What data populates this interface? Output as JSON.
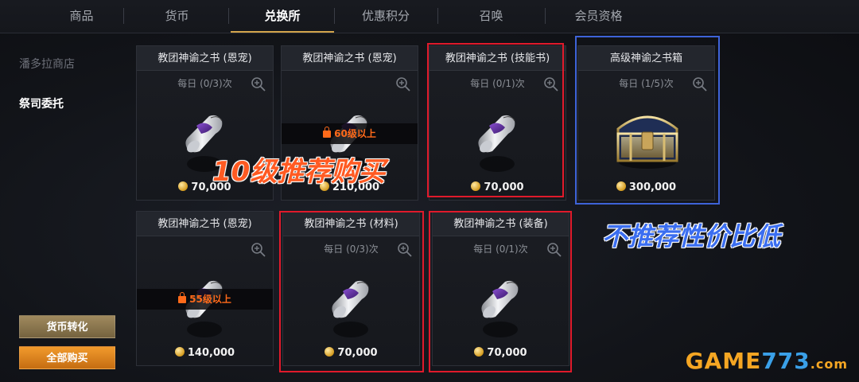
{
  "tabs": [
    {
      "label": "商品",
      "active": false
    },
    {
      "label": "货币",
      "active": false
    },
    {
      "label": "兑换所",
      "active": true
    },
    {
      "label": "优惠积分",
      "active": false
    },
    {
      "label": "召唤",
      "active": false
    },
    {
      "label": "会员资格",
      "active": false
    }
  ],
  "sidebar": {
    "items": [
      {
        "label": "潘多拉商店",
        "active": false
      },
      {
        "label": "祭司委托",
        "active": true
      }
    ],
    "convert_button": "货币转化",
    "buy_all_button": "全部购买"
  },
  "cards": [
    {
      "title": "教团神谕之书 (恩宠)",
      "limit": "每日 (0/3)次",
      "price": "70,000",
      "lock": "",
      "icon": "scroll-icon"
    },
    {
      "title": "教团神谕之书 (恩宠)",
      "limit": "",
      "price": "210,000",
      "lock": "60级以上",
      "icon": "scroll-icon"
    },
    {
      "title": "教团神谕之书 (技能书)",
      "limit": "每日 (0/1)次",
      "price": "70,000",
      "lock": "",
      "icon": "scroll-icon"
    },
    {
      "title": "高级神谕之书箱",
      "limit": "每日 (1/5)次",
      "price": "300,000",
      "lock": "",
      "icon": "treasure-chest-icon"
    },
    {
      "title": "教团神谕之书 (恩宠)",
      "limit": "",
      "price": "140,000",
      "lock": "55级以上",
      "icon": "scroll-icon"
    },
    {
      "title": "教团神谕之书 (材料)",
      "limit": "每日 (0/3)次",
      "price": "70,000",
      "lock": "",
      "icon": "scroll-icon"
    },
    {
      "title": "教团神谕之书 (装备)",
      "limit": "每日 (0/1)次",
      "price": "70,000",
      "lock": "",
      "icon": "scroll-icon"
    }
  ],
  "annotations": {
    "recommend": "10级推荐购买",
    "not_recommend": "不推荐性价比低"
  },
  "watermark": {
    "game": "GAME",
    "num": "773",
    "dom": ".com"
  },
  "colors": {
    "accent_gold": "#d2a44b",
    "lock_orange": "#ff6a1a",
    "highlight_red": "#e01a2b",
    "highlight_blue": "#3e63d8"
  }
}
